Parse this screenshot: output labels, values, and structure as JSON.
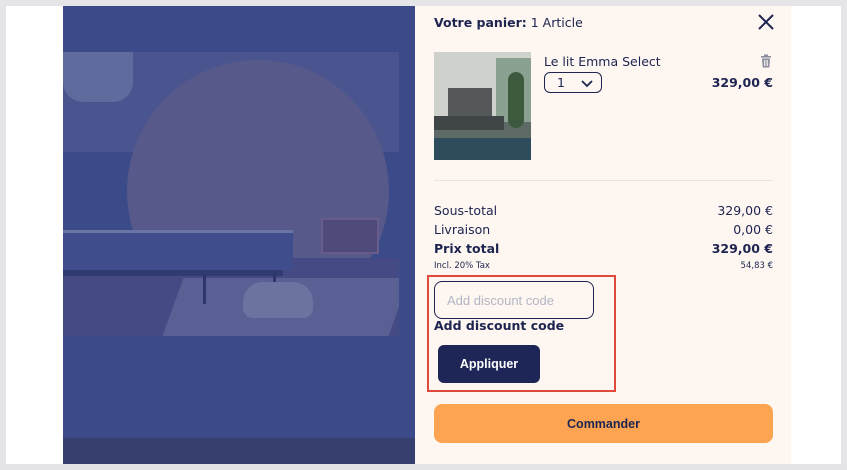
{
  "cart": {
    "title_bold": "Votre panier:",
    "title_count": "1 Article"
  },
  "icons": {
    "close": "close-icon",
    "trash": "trash-icon",
    "chevron": "chevron-down-icon"
  },
  "item": {
    "name": "Le lit Emma Select",
    "quantity": "1",
    "price": "329,00 €"
  },
  "summary": {
    "subtotal_label": "Sous-total",
    "subtotal_value": "329,00 €",
    "shipping_label": "Livraison",
    "shipping_value": "0,00 €",
    "total_label": "Prix total",
    "total_value": "329,00 €",
    "tax_label": "Incl. 20% Tax",
    "tax_value": "54,83 €"
  },
  "discount": {
    "placeholder": "Add discount code",
    "label": "Add discount code",
    "apply_label": "Appliquer"
  },
  "checkout": {
    "order_label": "Commander"
  },
  "colors": {
    "navy": "#1d2450",
    "panel_bg": "#fdf6f1",
    "accent_orange": "#fca451",
    "button_navy": "#1d2656",
    "highlight_red": "#e04a3a",
    "overlay": "#3d4a8a"
  }
}
